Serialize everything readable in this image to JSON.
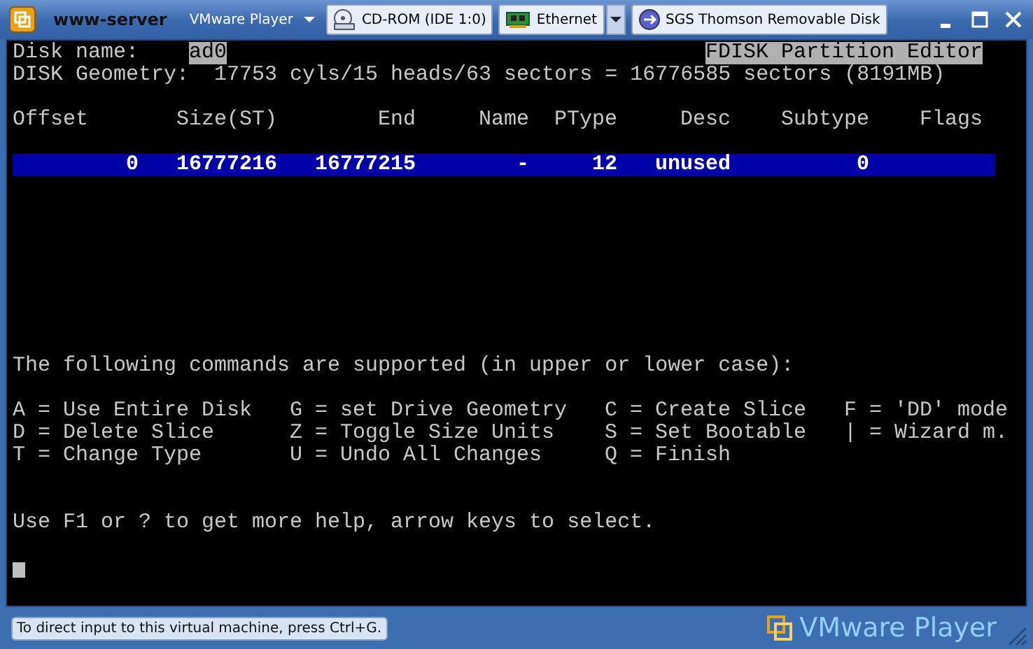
{
  "window": {
    "title": "www-server",
    "menu": "VMware Player"
  },
  "devices": [
    {
      "label": "CD-ROM (IDE 1:0)",
      "kind": "cdrom"
    },
    {
      "label": "Ethernet",
      "kind": "network"
    },
    {
      "label": "SGS Thomson Removable Disk",
      "kind": "usb"
    }
  ],
  "console": {
    "disk_name_label": "Disk name:",
    "disk_name": "ad0",
    "editor_title": "FDISK Partition Editor",
    "geometry": "DISK Geometry:  17753 cyls/15 heads/63 sectors = 16776585 sectors (8191MB)",
    "columns": [
      "Offset",
      "Size(ST)",
      "End",
      "Name",
      "PType",
      "Desc",
      "Subtype",
      "Flags"
    ],
    "rows": [
      {
        "selected": true,
        "cells": [
          "0",
          "16777216",
          "16777215",
          "-",
          "12",
          "unused",
          "0",
          ""
        ]
      }
    ],
    "commands_intro": "The following commands are supported (in upper or lower case):",
    "commands": [
      [
        "A = Use Entire Disk",
        "G = set Drive Geometry",
        "C = Create Slice",
        "F = 'DD' mode"
      ],
      [
        "D = Delete Slice",
        "Z = Toggle Size Units",
        "S = Set Bootable",
        "| = Wizard m."
      ],
      [
        "T = Change Type",
        "U = Undo All Changes",
        "Q = Finish"
      ]
    ],
    "help": "Use F1 or ? to get more help, arrow keys to select."
  },
  "status_bar": {
    "hint": "To direct input to this virtual machine, press Ctrl+G.",
    "brand": "VMware Player"
  }
}
